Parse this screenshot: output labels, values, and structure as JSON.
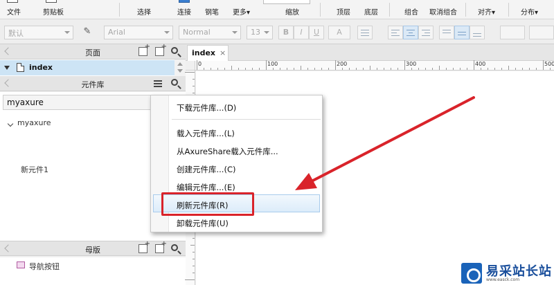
{
  "ribbon": {
    "file": "文件",
    "clipboard": "剪贴板",
    "select": "选择",
    "connect": "连接",
    "pen": "钢笔",
    "more": "更多▾",
    "zoom": "缩放",
    "top": "顶层",
    "bottom": "底层",
    "group": "组合",
    "ungroup": "取消组合",
    "align": "对齐▾",
    "distribute": "分布▾"
  },
  "format": {
    "style": "默认",
    "font": "Arial",
    "weight": "Normal",
    "size": "13",
    "bold": "B",
    "italic": "I",
    "underline": "U",
    "color": "A"
  },
  "pages": {
    "title": "页面",
    "items": [
      "index"
    ]
  },
  "library": {
    "title": "元件库",
    "selected": "myaxure",
    "tree_root": "myaxure",
    "items": [
      "新元件1"
    ]
  },
  "masters": {
    "title": "母版",
    "items": [
      "导航按钮"
    ]
  },
  "canvas": {
    "tab": "index",
    "tab_close": "×",
    "ruler": [
      "0",
      "100",
      "200",
      "300",
      "400",
      "500"
    ]
  },
  "context_menu": {
    "items": [
      "下载元件库...(D)",
      "载入元件库...(L)",
      "从AxureShare载入元件库...",
      "创建元件库...(C)",
      "编辑元件库...(E)",
      "刷新元件库(R)",
      "卸载元件库(U)"
    ],
    "highlighted": "刷新元件库(R)"
  },
  "watermark": {
    "brand": "易采站长站",
    "url": "www.easck.com"
  },
  "colors": {
    "highlight_box": "#d9232a",
    "arrow": "#d9232a",
    "selection": "#cde4f5"
  }
}
